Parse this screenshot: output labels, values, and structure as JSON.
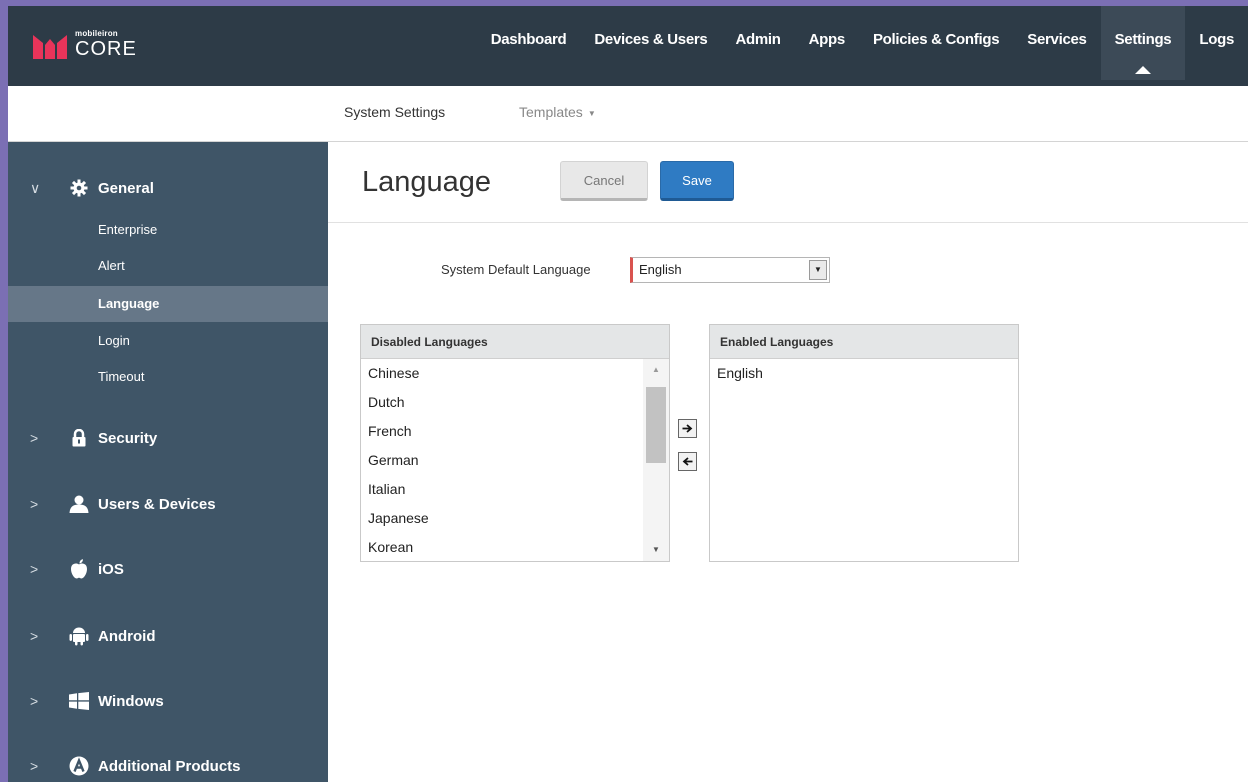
{
  "brand": {
    "small": "mobileiron",
    "big": "CORE",
    "color": "#e8345a"
  },
  "topnav": {
    "items": [
      {
        "label": "Dashboard"
      },
      {
        "label": "Devices & Users"
      },
      {
        "label": "Admin"
      },
      {
        "label": "Apps"
      },
      {
        "label": "Policies & Configs"
      },
      {
        "label": "Services"
      },
      {
        "label": "Settings",
        "active": true
      },
      {
        "label": "Logs"
      }
    ]
  },
  "subnav": {
    "system_settings": "System Settings",
    "templates": "Templates"
  },
  "sidebar": {
    "groups": [
      {
        "label": "General",
        "icon": "gear-icon",
        "expanded": true,
        "items": [
          {
            "label": "Enterprise"
          },
          {
            "label": "Alert"
          },
          {
            "label": "Language",
            "active": true
          },
          {
            "label": "Login"
          },
          {
            "label": "Timeout"
          }
        ]
      },
      {
        "label": "Security",
        "icon": "lock-icon"
      },
      {
        "label": "Users & Devices",
        "icon": "user-icon"
      },
      {
        "label": "iOS",
        "icon": "apple-icon"
      },
      {
        "label": "Android",
        "icon": "android-icon"
      },
      {
        "label": "Windows",
        "icon": "windows-icon"
      },
      {
        "label": "Additional Products",
        "icon": "a-circle-icon"
      }
    ]
  },
  "main": {
    "title": "Language",
    "cancel_label": "Cancel",
    "save_label": "Save",
    "default_language_label": "System Default Language",
    "default_language_value": "English",
    "disabled_header": "Disabled Languages",
    "enabled_header": "Enabled Languages",
    "disabled_languages": [
      "Chinese",
      "Dutch",
      "French",
      "German",
      "Italian",
      "Japanese",
      "Korean"
    ],
    "enabled_languages": [
      "English"
    ]
  },
  "colors": {
    "topbar": "#2d3b47",
    "sidebar": "#3f5567",
    "sidebar_active": "#667788",
    "save_button": "#2f7bc3",
    "required_marker": "#d9534f"
  }
}
